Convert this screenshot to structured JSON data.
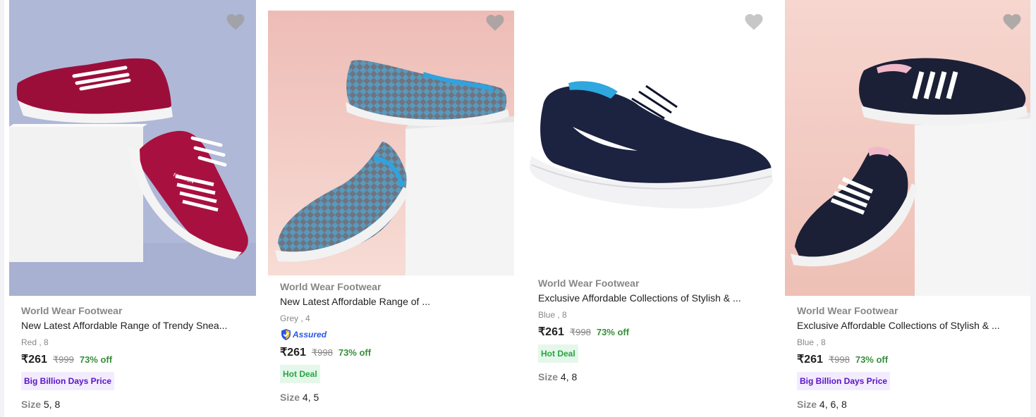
{
  "products": [
    {
      "brand": "World Wear Footwear",
      "title": "New Latest Affordable Range of Trendy Snea...",
      "variant": "Red , 8",
      "price": "₹261",
      "mrp": "₹999",
      "discount": "73% off",
      "badge": "Big Billion Days Price",
      "size_label": "Size",
      "sizes": "5, 8",
      "image": "red-sneakers-photo",
      "bg": "#b2bad8"
    },
    {
      "brand": "World Wear Footwear",
      "title": "New Latest Affordable Range of ...",
      "variant": "Grey , 4",
      "assured": "Assured",
      "price": "₹261",
      "mrp": "₹998",
      "discount": "73% off",
      "badge": "Hot Deal",
      "size_label": "Size",
      "sizes": "4, 5",
      "image": "grey-slip-on-photo",
      "bg": "#f2c4bd"
    },
    {
      "brand": "World Wear Footwear",
      "title": "Exclusive Affordable Collections of Stylish & ...",
      "variant": "Blue , 8",
      "price": "₹261",
      "mrp": "₹998",
      "discount": "73% off",
      "badge": "Hot Deal",
      "size_label": "Size",
      "sizes": "4, 8",
      "image": "navy-sneaker-photo",
      "bg": "#ffffff"
    },
    {
      "brand": "World Wear Footwear",
      "title": "Exclusive Affordable Collections of Stylish & ...",
      "variant": "Blue , 8",
      "price": "₹261",
      "mrp": "₹998",
      "discount": "73% off",
      "badge": "Big Billion Days Price",
      "size_label": "Size",
      "sizes": "4, 6, 8",
      "image": "navy-pink-sneakers-photo",
      "bg": "#f3cfc7"
    }
  ],
  "icons": {
    "wishlist": "heart-icon",
    "assured": "shield-check-icon"
  },
  "colors": {
    "price_green": "#388e3c",
    "bbd_text": "#5a13c7",
    "hot_deal_text": "#26a541",
    "muted": "#878787"
  }
}
